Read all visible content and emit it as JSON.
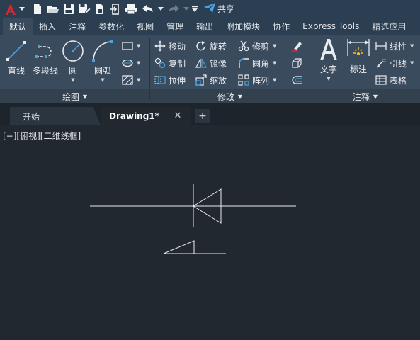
{
  "quick_access": {
    "share_label": "共享",
    "icons": [
      "autocad-logo",
      "new-icon",
      "open-icon",
      "save-icon",
      "save-as-icon",
      "publish-icon",
      "import-icon",
      "plot-icon",
      "undo-icon",
      "redo-icon",
      "share-icon"
    ]
  },
  "tabs": [
    {
      "label": "默认",
      "active": true
    },
    {
      "label": "插入"
    },
    {
      "label": "注释"
    },
    {
      "label": "参数化"
    },
    {
      "label": "视图"
    },
    {
      "label": "管理"
    },
    {
      "label": "输出"
    },
    {
      "label": "附加模块"
    },
    {
      "label": "协作"
    },
    {
      "label": "Express Tools"
    },
    {
      "label": "精选应用"
    }
  ],
  "ribbon": {
    "draw": {
      "title": "绘图",
      "line": "直线",
      "polyline": "多段线",
      "circle": "圆",
      "arc": "圆弧"
    },
    "modify": {
      "title": "修改",
      "move": "移动",
      "rotate": "旋转",
      "trim": "修剪",
      "copy": "复制",
      "mirror": "镜像",
      "fillet": "圆角",
      "stretch": "拉伸",
      "scale": "缩放",
      "array": "阵列"
    },
    "annotation": {
      "title": "注释",
      "text": "文字",
      "dimension": "标注",
      "linear": "线性",
      "leader": "引线",
      "table": "表格"
    }
  },
  "file_tabs": {
    "start": "开始",
    "drawing": "Drawing1*"
  },
  "viewport": {
    "label": "[−][俯视][二维线框]"
  },
  "colors": {
    "qat_bg": "#2c3e52",
    "ribbon_bg": "#3b4b5e",
    "canvas_bg": "#212830",
    "logo_red": "#d1292e",
    "accent_blue": "#4aa3df"
  }
}
